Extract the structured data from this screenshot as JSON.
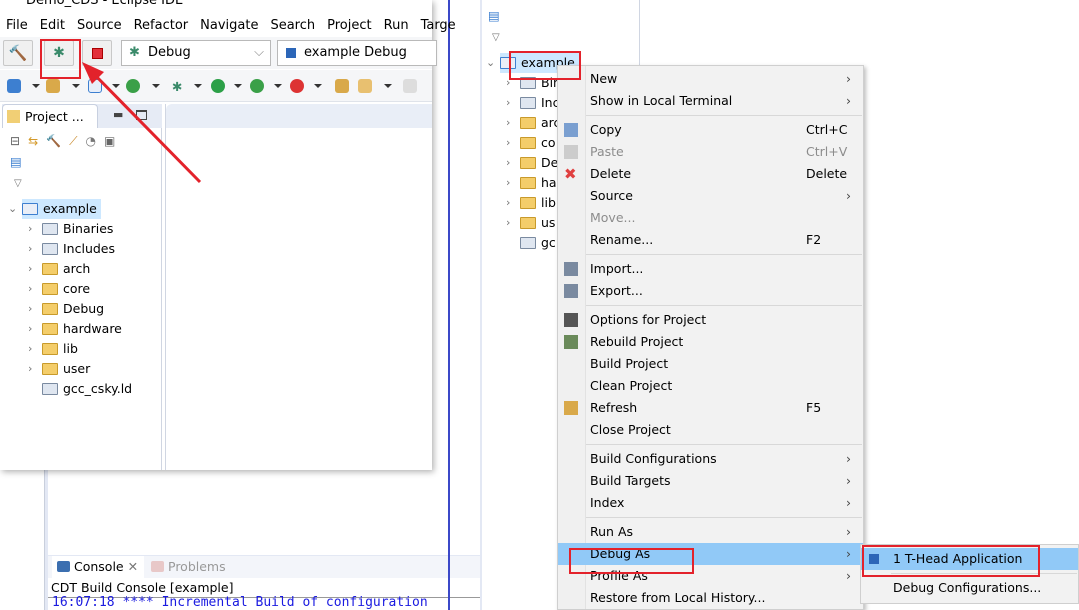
{
  "left_window": {
    "title": "Demo_CDS - Eclipse IDE",
    "menu": [
      "File",
      "Edit",
      "Source",
      "Refactor",
      "Navigate",
      "Search",
      "Project",
      "Run",
      "Targe"
    ],
    "toolbar": {
      "build": "hammer-icon",
      "debug": "bug-icon",
      "stop": "stop-icon",
      "launch_mode": "Debug",
      "launch_config": "example Debug"
    },
    "project_tab": "Project ...",
    "tree": {
      "project": "example",
      "items": [
        "Binaries",
        "Includes",
        "arch",
        "core",
        "Debug",
        "hardware",
        "lib",
        "user",
        "gcc_csky.ld"
      ]
    }
  },
  "console": {
    "tabs": [
      "Console",
      "Problems"
    ],
    "title": "CDT Build Console [example]",
    "line": "16:07:18 **** Incremental Build of configuration"
  },
  "right_tree": {
    "project": "example",
    "items": [
      "Bin",
      "Inc",
      "arc",
      "co",
      "De",
      "ha",
      "lib",
      "us",
      "gc"
    ]
  },
  "context_menu": {
    "items": [
      {
        "label": "New",
        "arrow": true
      },
      {
        "label": "Show in Local Terminal",
        "arrow": true
      },
      {
        "sep": true
      },
      {
        "label": "Copy",
        "shortcut": "Ctrl+C",
        "icon": "copy-icon"
      },
      {
        "label": "Paste",
        "shortcut": "Ctrl+V",
        "icon": "paste-icon",
        "disabled": true
      },
      {
        "label": "Delete",
        "shortcut": "Delete",
        "icon": "delete-icon"
      },
      {
        "label": "Source",
        "arrow": true
      },
      {
        "label": "Move...",
        "disabled": true
      },
      {
        "label": "Rename...",
        "shortcut": "F2"
      },
      {
        "sep": true
      },
      {
        "label": "Import...",
        "icon": "import-icon"
      },
      {
        "label": "Export...",
        "icon": "export-icon"
      },
      {
        "sep": true
      },
      {
        "label": "Options for Project",
        "icon": "options-icon"
      },
      {
        "label": "Rebuild Project",
        "icon": "rebuild-icon"
      },
      {
        "label": "Build Project"
      },
      {
        "label": "Clean Project"
      },
      {
        "label": "Refresh",
        "shortcut": "F5",
        "icon": "refresh-icon"
      },
      {
        "label": "Close Project"
      },
      {
        "sep": true
      },
      {
        "label": "Build Configurations",
        "arrow": true
      },
      {
        "label": "Build Targets",
        "arrow": true
      },
      {
        "label": "Index",
        "arrow": true
      },
      {
        "sep": true
      },
      {
        "label": "Run As",
        "arrow": true
      },
      {
        "label": "Debug As",
        "arrow": true,
        "highlighted": true
      },
      {
        "label": "Profile As",
        "arrow": true
      },
      {
        "label": "Restore from Local History..."
      }
    ]
  },
  "submenu": {
    "items": [
      "1 T-Head Application",
      "Debug Configurations..."
    ]
  },
  "colors": {
    "highlight": "#91c9f7",
    "annotation": "#e3222b",
    "accent_line": "#3b48c8"
  }
}
